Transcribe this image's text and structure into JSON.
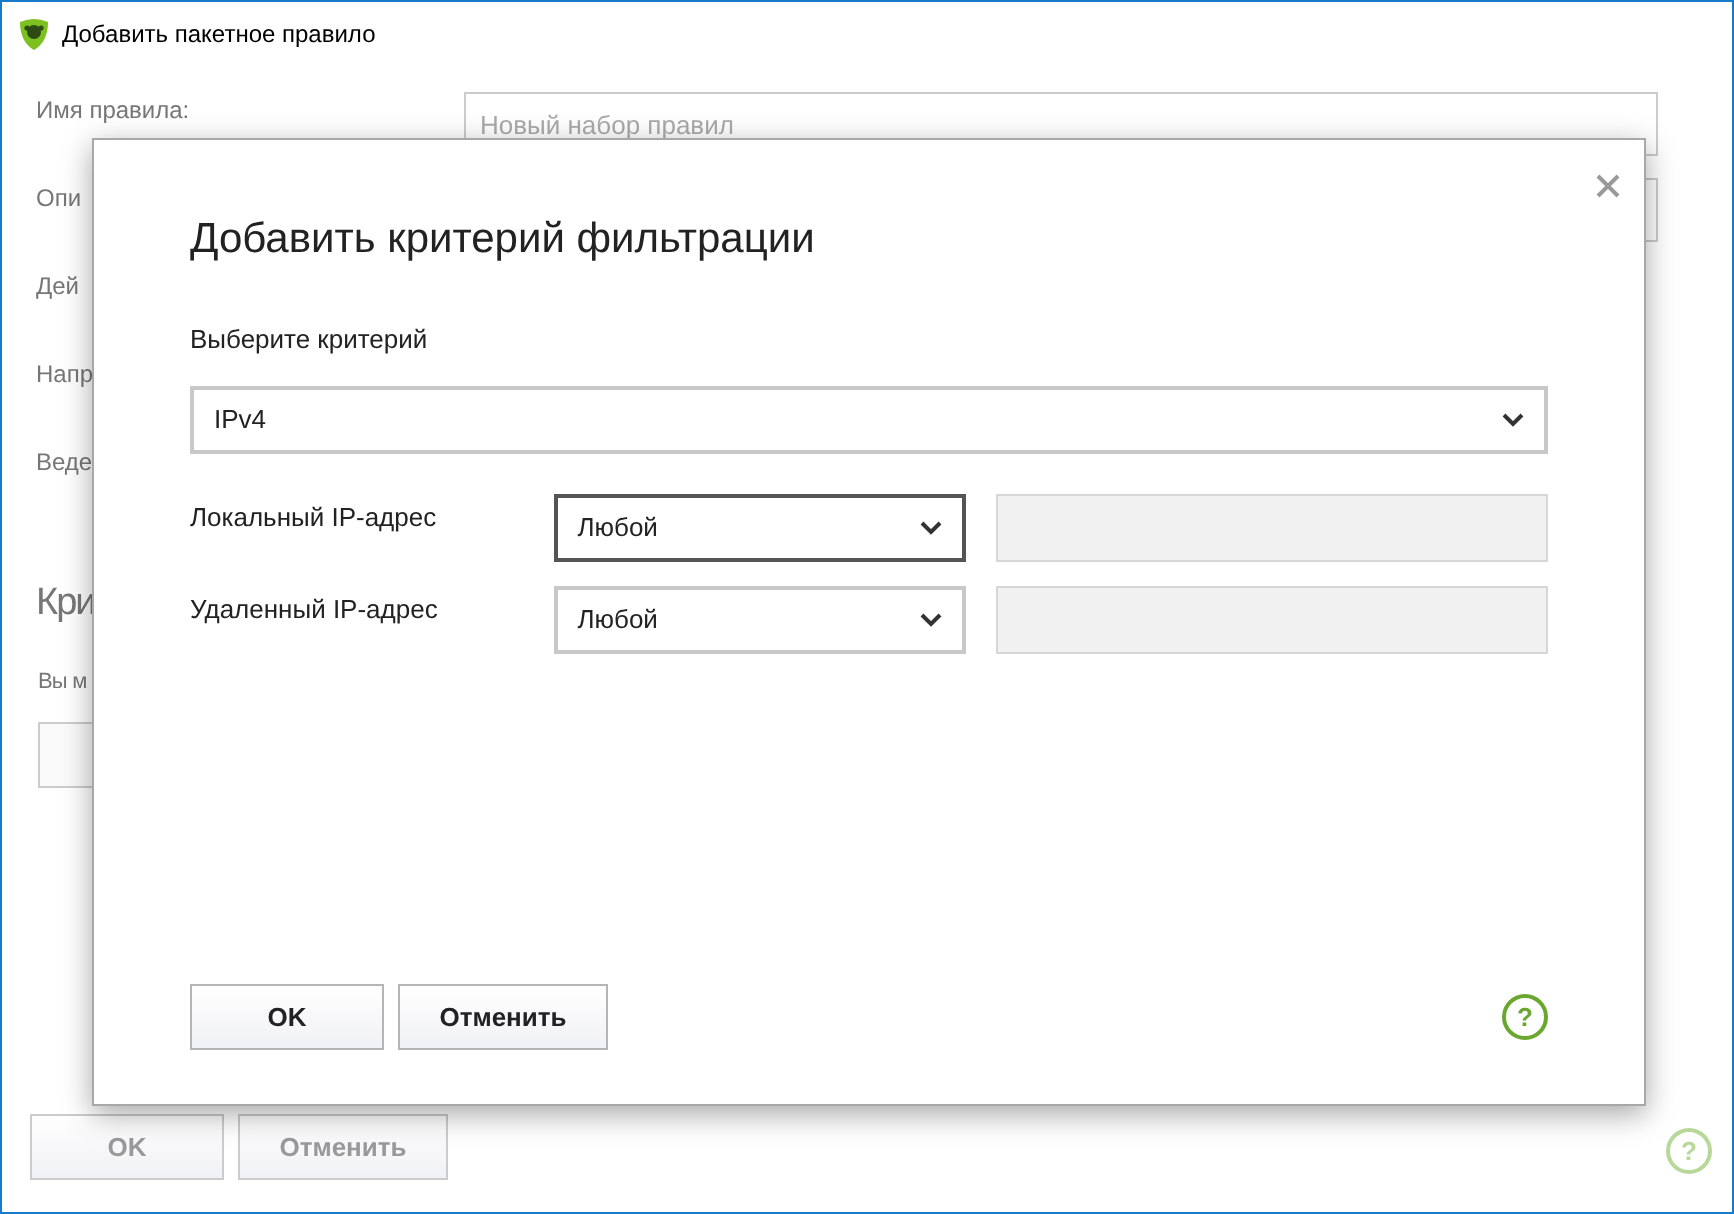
{
  "window": {
    "title": "Добавить пакетное правило",
    "help": "?"
  },
  "background_form": {
    "labels": [
      "Имя правила:",
      "Опи",
      "Дей",
      "Напр",
      "Веде"
    ],
    "name_field": {
      "placeholder": "Новый набор правил"
    },
    "section_title": "Кри",
    "section_text": "Вы м",
    "buttons": [
      {
        "label": "OK",
        "disabled": true
      },
      {
        "label": "Отменить",
        "disabled": true
      }
    ]
  },
  "dialog": {
    "title": "Добавить критерий фильтрации",
    "criterion_label": "Выберите критерий",
    "criterion": {
      "value": "IPv4"
    },
    "rows": [
      {
        "label": "Локальный IP-адрес",
        "value": "Любой",
        "focused": true,
        "address": {
          "disabled": true
        }
      },
      {
        "label": "Удаленный IP-адрес",
        "value": "Любой",
        "focused": false,
        "address": {
          "disabled": true
        }
      }
    ],
    "buttons": [
      {
        "label": "OK"
      },
      {
        "label": "Отменить"
      }
    ],
    "help": "?"
  }
}
